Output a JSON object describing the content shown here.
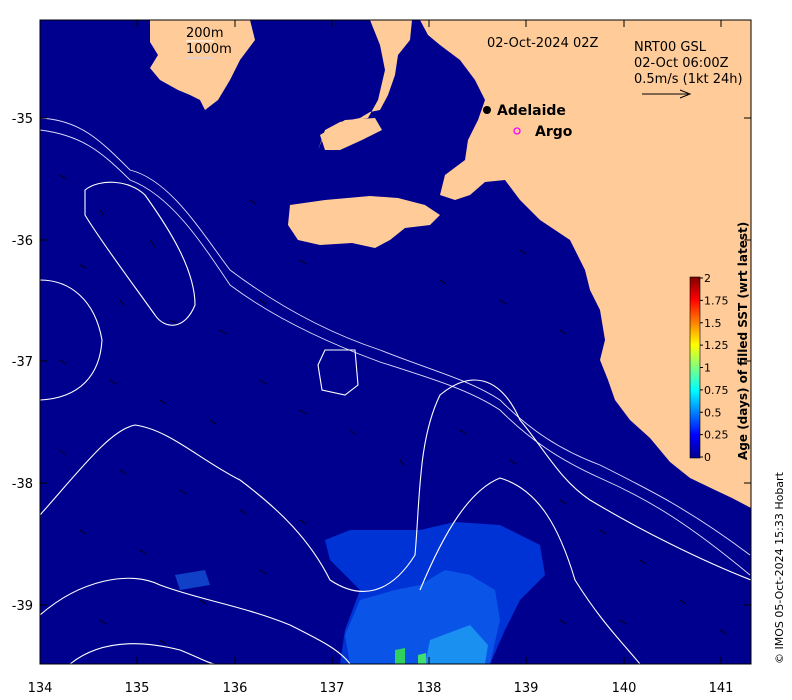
{
  "map": {
    "date_title": "02-Oct-2024 02Z",
    "depth_legend": [
      "200m",
      "1000m"
    ],
    "current_legend": [
      "NRT00 GSL",
      "02-Oct 06:00Z",
      "0.5m/s (1kt 24h)"
    ],
    "places": [
      {
        "name": "Adelaide",
        "lon": 138.6,
        "lat": -34.93
      },
      {
        "name": "Argo",
        "lon": 138.9,
        "lat": -35.11
      }
    ],
    "credit": "© IMOS 05-Oct-2024 15:33 Hobart",
    "lon_ticks": [
      "134",
      "135",
      "136",
      "137",
      "138",
      "139",
      "140",
      "141"
    ],
    "lat_ticks": [
      "-35",
      "-36",
      "-37",
      "-38",
      "-39"
    ],
    "extent": {
      "lon": [
        134,
        141.3
      ],
      "lat": [
        -39.5,
        -34.2
      ]
    },
    "colors": {
      "ocean": "#00008F",
      "land": "#FFCC99",
      "contour": "#FFFFFF",
      "argo": "#FF00FF"
    }
  },
  "colorbar": {
    "title": "Age (days) of filled SST (wrt latest)",
    "ticks": [
      "0",
      "0.25",
      "0.5",
      "0.75",
      "1",
      "1.25",
      "1.5",
      "1.75",
      "2"
    ],
    "range": [
      0,
      2
    ],
    "colormap": "jet"
  }
}
